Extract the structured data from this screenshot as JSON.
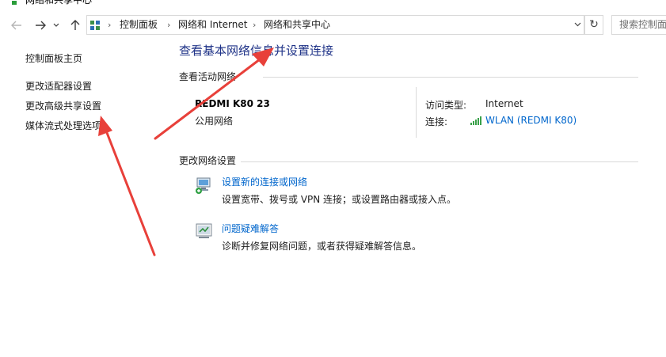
{
  "window": {
    "title": "网络和共享中心"
  },
  "nav": {
    "back_icon": "back-arrow-icon",
    "forward_icon": "forward-arrow-icon",
    "recent_icon": "chevron-down-icon",
    "up_icon": "up-arrow-icon"
  },
  "address": {
    "crumbs": [
      "控制面板",
      "网络和 Internet",
      "网络和共享中心"
    ],
    "separator": "›",
    "dropdown": "⌄",
    "refresh": "↻"
  },
  "search": {
    "placeholder": "搜索控制面板"
  },
  "sidebar": {
    "items": [
      {
        "label": "控制面板主页"
      },
      {
        "label": "更改适配器设置"
      },
      {
        "label": "更改高级共享设置"
      },
      {
        "label": "媒体流式处理选项"
      }
    ]
  },
  "main": {
    "title": "查看基本网络信息并设置连接",
    "active_section": "查看活动网络",
    "network": {
      "name": "REDMI K80 23",
      "type": "公用网络",
      "access_label": "访问类型:",
      "access_value": "Internet",
      "connection_label": "连接:",
      "connection_value": "WLAN (REDMI K80)"
    },
    "change_section": "更改网络设置",
    "tasks": [
      {
        "link": "设置新的连接或网络",
        "desc": "设置宽带、拨号或 VPN 连接；或设置路由器或接入点。",
        "icon": "new-connection-icon"
      },
      {
        "link": "问题疑难解答",
        "desc": "诊断并修复网络问题，或者获得疑难解答信息。",
        "icon": "troubleshoot-icon"
      }
    ]
  },
  "colors": {
    "title_blue": "#1e3287",
    "link_blue": "#0066cc",
    "annotation_red": "#e8403a",
    "divider": "#d9d9d9"
  }
}
